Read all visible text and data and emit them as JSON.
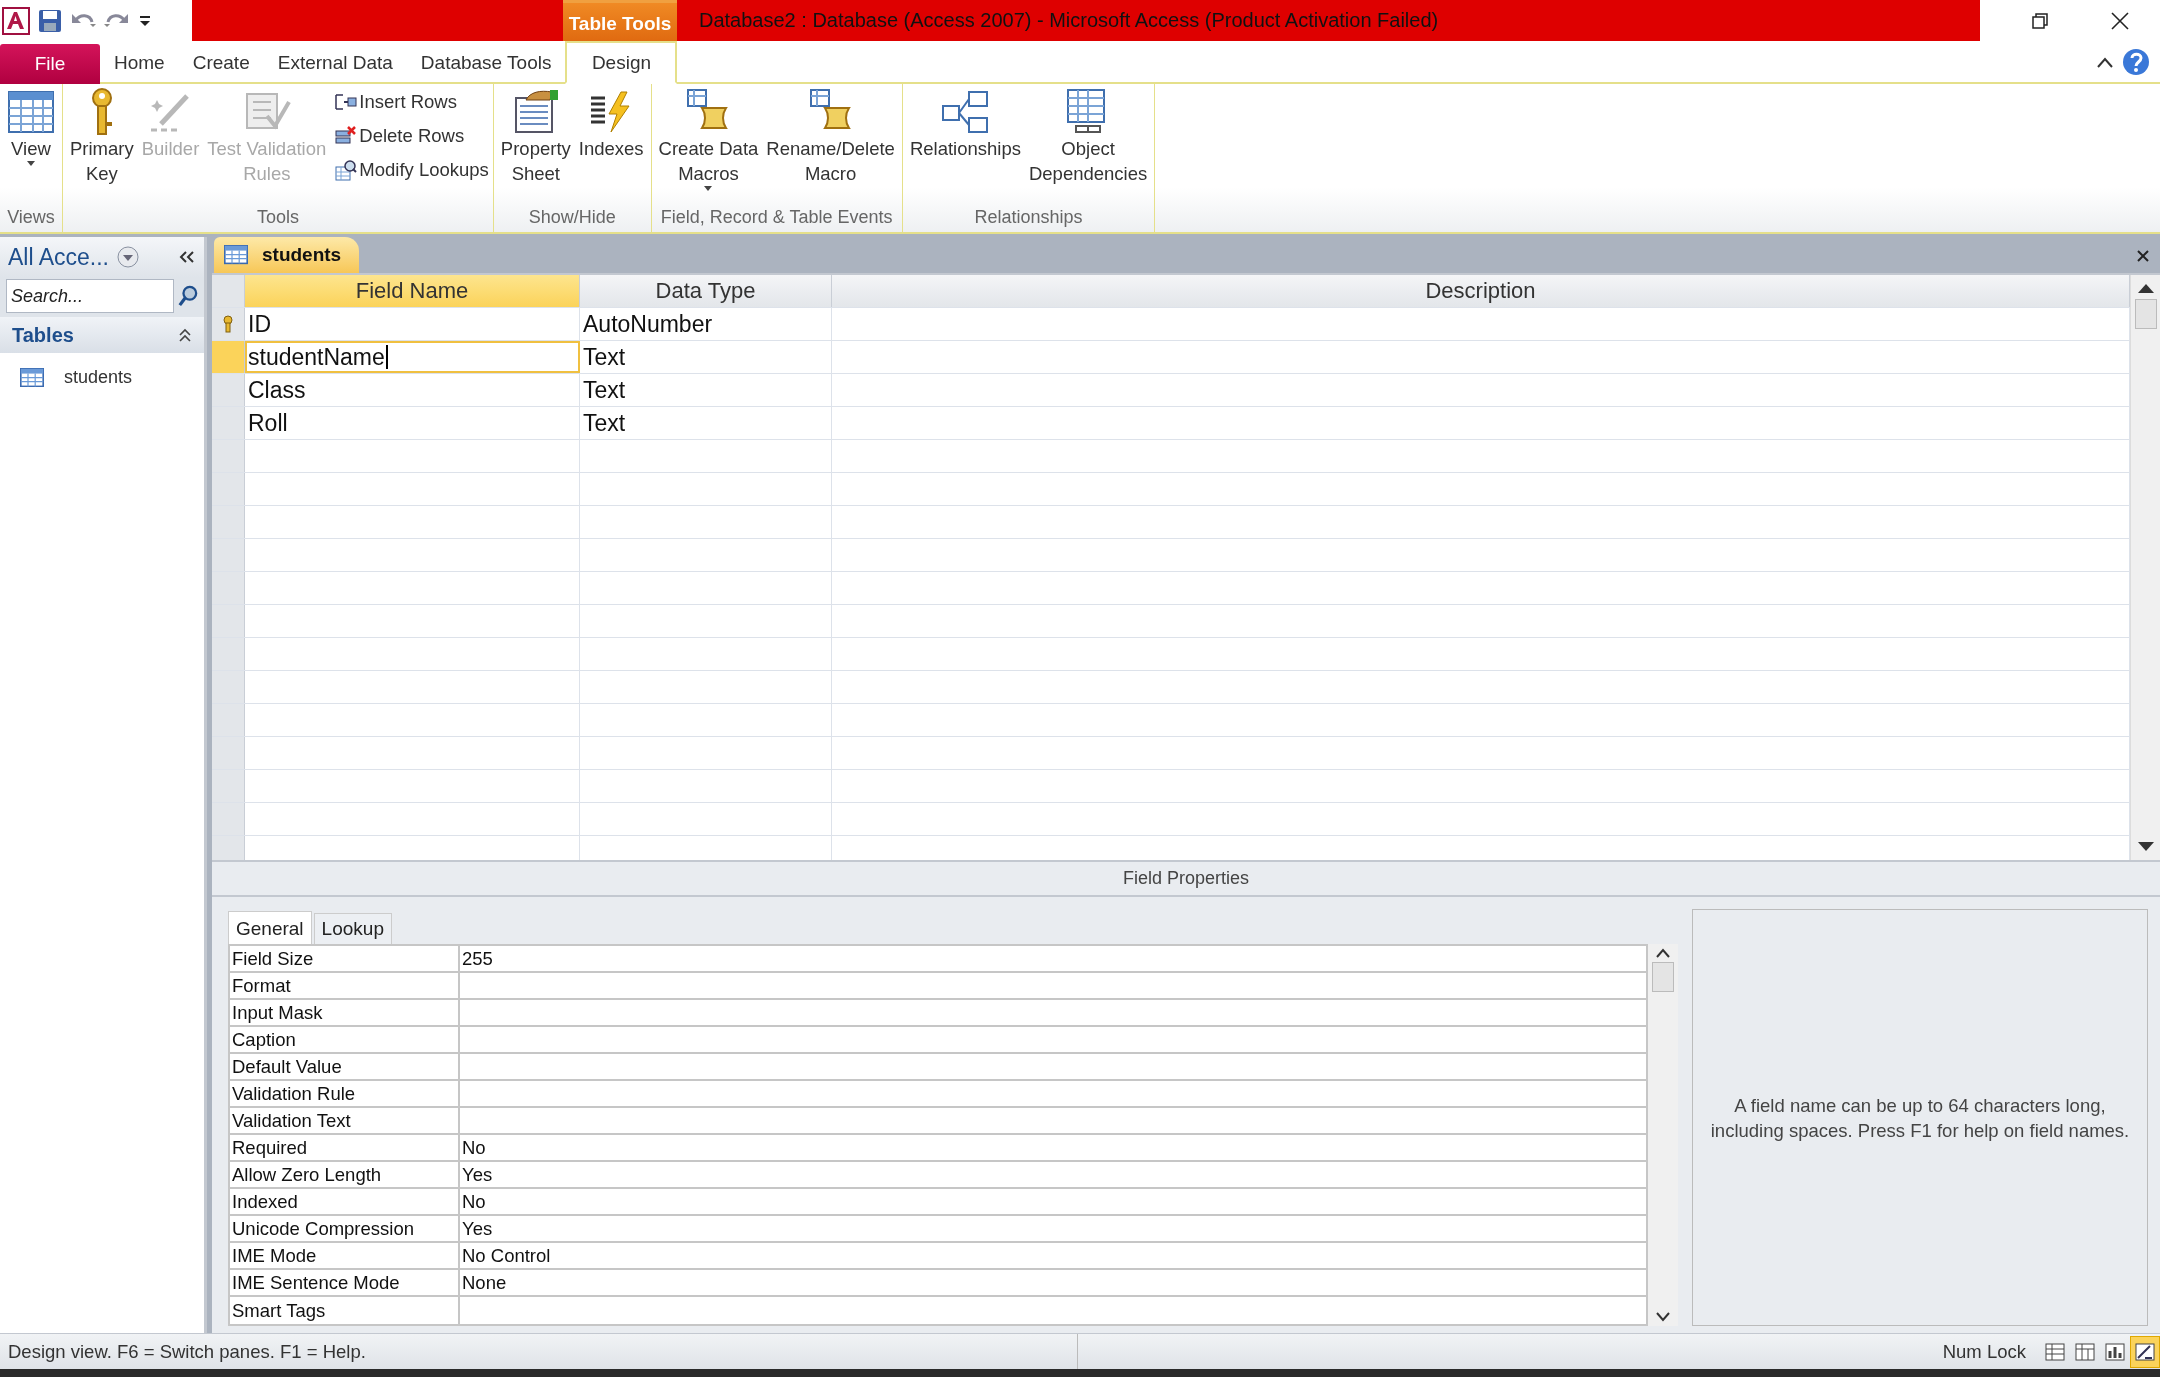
{
  "quick_access": {
    "buttons": [
      {
        "kind": "save"
      },
      {
        "kind": "undo"
      },
      {
        "kind": "redo"
      },
      {
        "kind": "customize"
      }
    ]
  },
  "contextual_tab": {
    "label": "Table Tools"
  },
  "window": {
    "title": "Database2 : Database (Access 2007)  -  Microsoft Access (Product Activation Failed)"
  },
  "ribbon_tabs": [
    {
      "label": "File",
      "selected": false,
      "kind": "file"
    },
    {
      "label": "Home",
      "selected": false,
      "kind": "tab"
    },
    {
      "label": "Create",
      "selected": false,
      "kind": "tab"
    },
    {
      "label": "External Data",
      "selected": false,
      "kind": "tab"
    },
    {
      "label": "Database Tools",
      "selected": false,
      "kind": "tab"
    },
    {
      "label": "Design",
      "selected": true,
      "kind": "tab"
    }
  ],
  "ribbon_groups": [
    {
      "label": "Views",
      "buttons": [
        {
          "kind": "large",
          "label": "View",
          "dropdown": true,
          "disabled": false
        }
      ]
    },
    {
      "label": "Tools",
      "buttons": [
        {
          "kind": "large",
          "label": "Primary\nKey",
          "disabled": false
        },
        {
          "kind": "large",
          "label": "Builder",
          "disabled": true
        },
        {
          "kind": "large",
          "label": "Test Validation\nRules",
          "disabled": true
        },
        {
          "kind": "small",
          "label": "Insert Rows",
          "disabled": false
        },
        {
          "kind": "small",
          "label": "Delete Rows",
          "disabled": false
        },
        {
          "kind": "small",
          "label": "Modify Lookups",
          "disabled": false
        }
      ]
    },
    {
      "label": "Show/Hide",
      "buttons": [
        {
          "kind": "large",
          "label": "Property\nSheet",
          "disabled": false
        },
        {
          "kind": "large",
          "label": "Indexes",
          "disabled": false
        }
      ]
    },
    {
      "label": "Field, Record & Table Events",
      "buttons": [
        {
          "kind": "large",
          "label": "Create Data\nMacros",
          "dropdown": true,
          "disabled": false
        },
        {
          "kind": "large",
          "label": "Rename/Delete\nMacro",
          "disabled": false
        }
      ]
    },
    {
      "label": "Relationships",
      "buttons": [
        {
          "kind": "large",
          "label": "Relationships",
          "disabled": false
        },
        {
          "kind": "large",
          "label": "Object\nDependencies",
          "disabled": false
        }
      ]
    }
  ],
  "navigation_pane": {
    "title": "All Acce...",
    "search": {
      "placeholder": "Search..."
    },
    "group": "Tables",
    "items": [
      {
        "label": "students",
        "selected": false
      }
    ]
  },
  "document_tab": {
    "label": "students"
  },
  "design_grid": {
    "columns": [
      "Field Name",
      "Data Type",
      "Description"
    ],
    "rows": [
      {
        "field_name": "ID",
        "data_type": "AutoNumber",
        "primary_key": true,
        "selected": false
      },
      {
        "field_name": "studentName",
        "data_type": "Text",
        "primary_key": false,
        "selected": true
      },
      {
        "field_name": "Class",
        "data_type": "Text",
        "primary_key": false,
        "selected": false
      },
      {
        "field_name": "Roll",
        "data_type": "Text",
        "primary_key": false,
        "selected": false
      }
    ]
  },
  "field_properties": {
    "title": "Field Properties",
    "tabs": [
      {
        "label": "General",
        "selected": true
      },
      {
        "label": "Lookup",
        "selected": false
      }
    ],
    "rows": [
      {
        "label": "Field Size",
        "value": "255"
      },
      {
        "label": "Format"
      },
      {
        "label": "Input Mask"
      },
      {
        "label": "Caption"
      },
      {
        "label": "Default Value"
      },
      {
        "label": "Validation Rule"
      },
      {
        "label": "Validation Text"
      },
      {
        "label": "Required",
        "value": "No"
      },
      {
        "label": "Allow Zero Length",
        "value": "Yes"
      },
      {
        "label": "Indexed",
        "value": "No"
      },
      {
        "label": "Unicode Compression",
        "value": "Yes"
      },
      {
        "label": "IME Mode",
        "value": "No Control"
      },
      {
        "label": "IME Sentence Mode",
        "value": "None"
      },
      {
        "label": "Smart Tags"
      }
    ],
    "help_text": "A field name can be up to 64 characters long, including spaces. Press F1 for help on field names."
  },
  "status_bar": {
    "text": "Design view.  F6 = Switch panes.  F1 = Help.",
    "indicator": "Num Lock",
    "views": [
      {
        "kind": "datasheet",
        "selected": false
      },
      {
        "kind": "pivottable",
        "selected": false
      },
      {
        "kind": "pivotchart",
        "selected": false
      },
      {
        "kind": "design",
        "selected": true
      }
    ]
  }
}
